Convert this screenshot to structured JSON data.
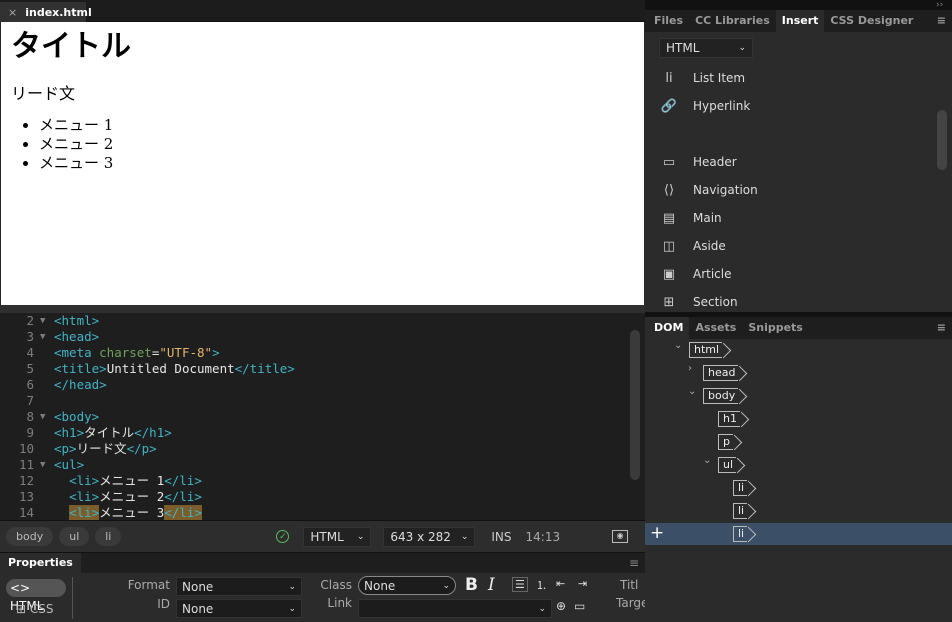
{
  "document_tab": {
    "filename": "index.html",
    "close_icon": "×"
  },
  "design_view": {
    "h1": "タイトル",
    "p": "リード文",
    "list": [
      "メニュー 1",
      "メニュー 2",
      "メニュー 3"
    ]
  },
  "code_view": {
    "lines": [
      {
        "n": "2",
        "fold": true,
        "segs": [
          [
            "<html>",
            "tag"
          ]
        ]
      },
      {
        "n": "3",
        "fold": true,
        "segs": [
          [
            "<head>",
            "tag"
          ]
        ]
      },
      {
        "n": "4",
        "segs": [
          [
            "<meta ",
            "tag"
          ],
          [
            "charset",
            "attr"
          ],
          [
            "=",
            "txt"
          ],
          [
            "\"UTF-8\"",
            "str"
          ],
          [
            ">",
            "tag"
          ]
        ]
      },
      {
        "n": "5",
        "segs": [
          [
            "<title>",
            "tag"
          ],
          [
            "Untitled Document",
            "txt"
          ],
          [
            "</title>",
            "tag"
          ]
        ]
      },
      {
        "n": "6",
        "segs": [
          [
            "</head>",
            "tag"
          ]
        ]
      },
      {
        "n": "7",
        "segs": []
      },
      {
        "n": "8",
        "fold": true,
        "segs": [
          [
            "<body>",
            "tag"
          ]
        ]
      },
      {
        "n": "9",
        "segs": [
          [
            "<h1>",
            "tag"
          ],
          [
            "タイトル",
            "txt"
          ],
          [
            "</h1>",
            "tag"
          ]
        ]
      },
      {
        "n": "10",
        "segs": [
          [
            "<p>",
            "tag"
          ],
          [
            "リード文",
            "txt"
          ],
          [
            "</p>",
            "tag"
          ]
        ]
      },
      {
        "n": "11",
        "fold": true,
        "segs": [
          [
            "<ul>",
            "tag"
          ]
        ]
      },
      {
        "n": "12",
        "segs": [
          [
            "  ",
            "txt"
          ],
          [
            "<li>",
            "tag"
          ],
          [
            "メニュー 1",
            "txt"
          ],
          [
            "</li>",
            "tag"
          ]
        ]
      },
      {
        "n": "13",
        "segs": [
          [
            "  ",
            "txt"
          ],
          [
            "<li>",
            "tag"
          ],
          [
            "メニュー 2",
            "txt"
          ],
          [
            "</li>",
            "tag"
          ]
        ]
      },
      {
        "n": "14",
        "segs": [
          [
            "  ",
            "txt"
          ],
          [
            "<li>",
            "tag hl"
          ],
          [
            "メニュー 3",
            "txt"
          ],
          [
            "</li>",
            "tag hl"
          ]
        ]
      }
    ]
  },
  "status_bar": {
    "breadcrumbs": [
      "body",
      "ul",
      "li"
    ],
    "doc_type": "HTML",
    "size": "643 x 282",
    "mode": "INS",
    "position": "14:13"
  },
  "properties": {
    "title": "Properties",
    "html_button": "HTML",
    "css_button": "CSS",
    "format_label": "Format",
    "format_value": "None",
    "id_label": "ID",
    "id_value": "None",
    "class_label": "Class",
    "class_value": "None",
    "link_label": "Link",
    "link_value": "",
    "bold": "B",
    "italic": "I",
    "title_label": "Titl",
    "target_label": "Targe"
  },
  "insert_panel": {
    "tabs": [
      "Files",
      "CC Libraries",
      "Insert",
      "CSS Designer"
    ],
    "active_tab": "Insert",
    "category": "HTML",
    "items": [
      {
        "label": "List Item",
        "icon": "li"
      },
      {
        "label": "Hyperlink",
        "icon": "🔗"
      },
      {
        "label": "Header",
        "icon": "▭"
      },
      {
        "label": "Navigation",
        "icon": "⟨⟩"
      },
      {
        "label": "Main",
        "icon": "▤"
      },
      {
        "label": "Aside",
        "icon": "◫"
      },
      {
        "label": "Article",
        "icon": "▣"
      },
      {
        "label": "Section",
        "icon": "⊞"
      }
    ]
  },
  "dom_panel": {
    "tabs": [
      "DOM",
      "Assets",
      "Snippets"
    ],
    "active_tab": "DOM",
    "nodes": [
      "html",
      "head",
      "body",
      "h1",
      "p",
      "ul",
      "li",
      "li",
      "li"
    ],
    "add_icon": "+"
  }
}
